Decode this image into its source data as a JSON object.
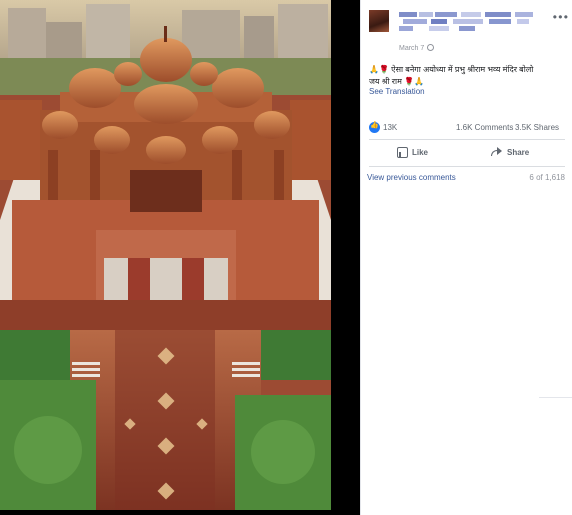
{
  "post": {
    "author_name": "",
    "date": "March 7",
    "text_line1": "ऐसा बनेगा अयोध्या में प्रभु श्रीराम भव्य मंदिर बोलो",
    "text_line2": "जय श्री राम",
    "see_translation": "See Translation"
  },
  "stats": {
    "likes": "13K",
    "comments": "1.6K Comments",
    "shares": "3.5K Shares"
  },
  "actions": {
    "like": "Like",
    "share": "Share"
  },
  "comments": {
    "view_previous": "View previous comments",
    "pager": "6 of 1,618"
  },
  "icons": [
    "more-options-icon",
    "close-icon",
    "globe-icon",
    "like-reaction-icon",
    "thumbs-up-icon",
    "share-icon"
  ],
  "colors": {
    "link": "#385898",
    "like_blue": "#2078f4",
    "muted": "#606770",
    "photo_stone": "#b0643e",
    "photo_plaza": "#a0452f"
  }
}
